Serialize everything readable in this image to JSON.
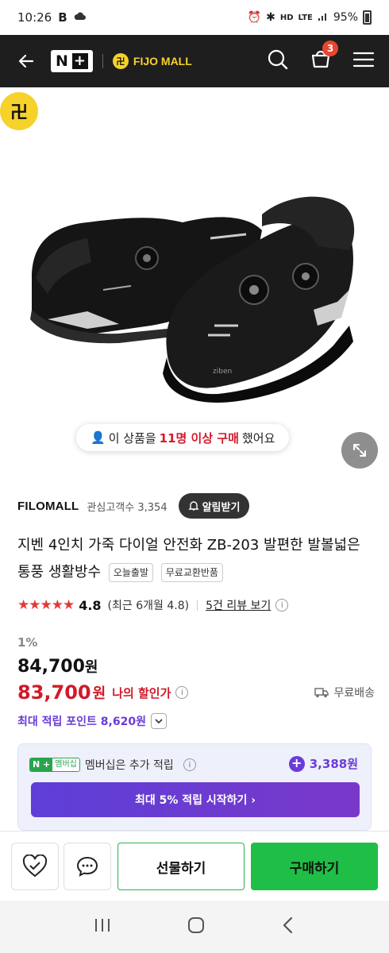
{
  "status": {
    "time": "10:26",
    "battery": "95%",
    "network": "LTE",
    "hd": "HD"
  },
  "header": {
    "logo_nplus": "N",
    "brand_text": "FIJO MALL",
    "cart_count": "3"
  },
  "hero": {
    "watermark": "FIJO MALL",
    "buy_notice_prefix": "이 상품을",
    "buy_notice_highlight": "11명 이상 구매",
    "buy_notice_suffix": "했어요"
  },
  "store": {
    "name": "FILOMALL",
    "watchers_label": "관심고객수",
    "watchers_count": "3,354",
    "notify_label": "알림받기"
  },
  "product": {
    "title": "지벤 4인치 가죽 다이얼 안전화 ZB-203 발편한 발볼넓은 통풍 생활방수",
    "tags": [
      "오늘출발",
      "무료교환반품"
    ]
  },
  "rating": {
    "stars": "★★★★★",
    "score": "4.8",
    "recent": "(최근 6개월 4.8)",
    "reviews_link": "5건 리뷰 보기"
  },
  "price": {
    "discount": "1%",
    "original": "84,700",
    "won": "원",
    "mine": "83,700",
    "mine_label": "나의 할인가",
    "shipping": "무료배송",
    "points": "최대 적립 포인트 8,620원"
  },
  "membership": {
    "badge_np": "N +",
    "badge_label": "멤버십",
    "text": "멤버십은 추가 적립",
    "bonus": "3,388원",
    "start_button": "최대 5% 적립 시작하기 ›"
  },
  "bottom": {
    "gift_label": "선물하기",
    "buy_label": "구매하기"
  },
  "colors": {
    "accent_green": "#1fbe46",
    "price_red": "#d11a2a",
    "member_purple": "#6a3bd8",
    "brand_yellow": "#f6d22a"
  }
}
